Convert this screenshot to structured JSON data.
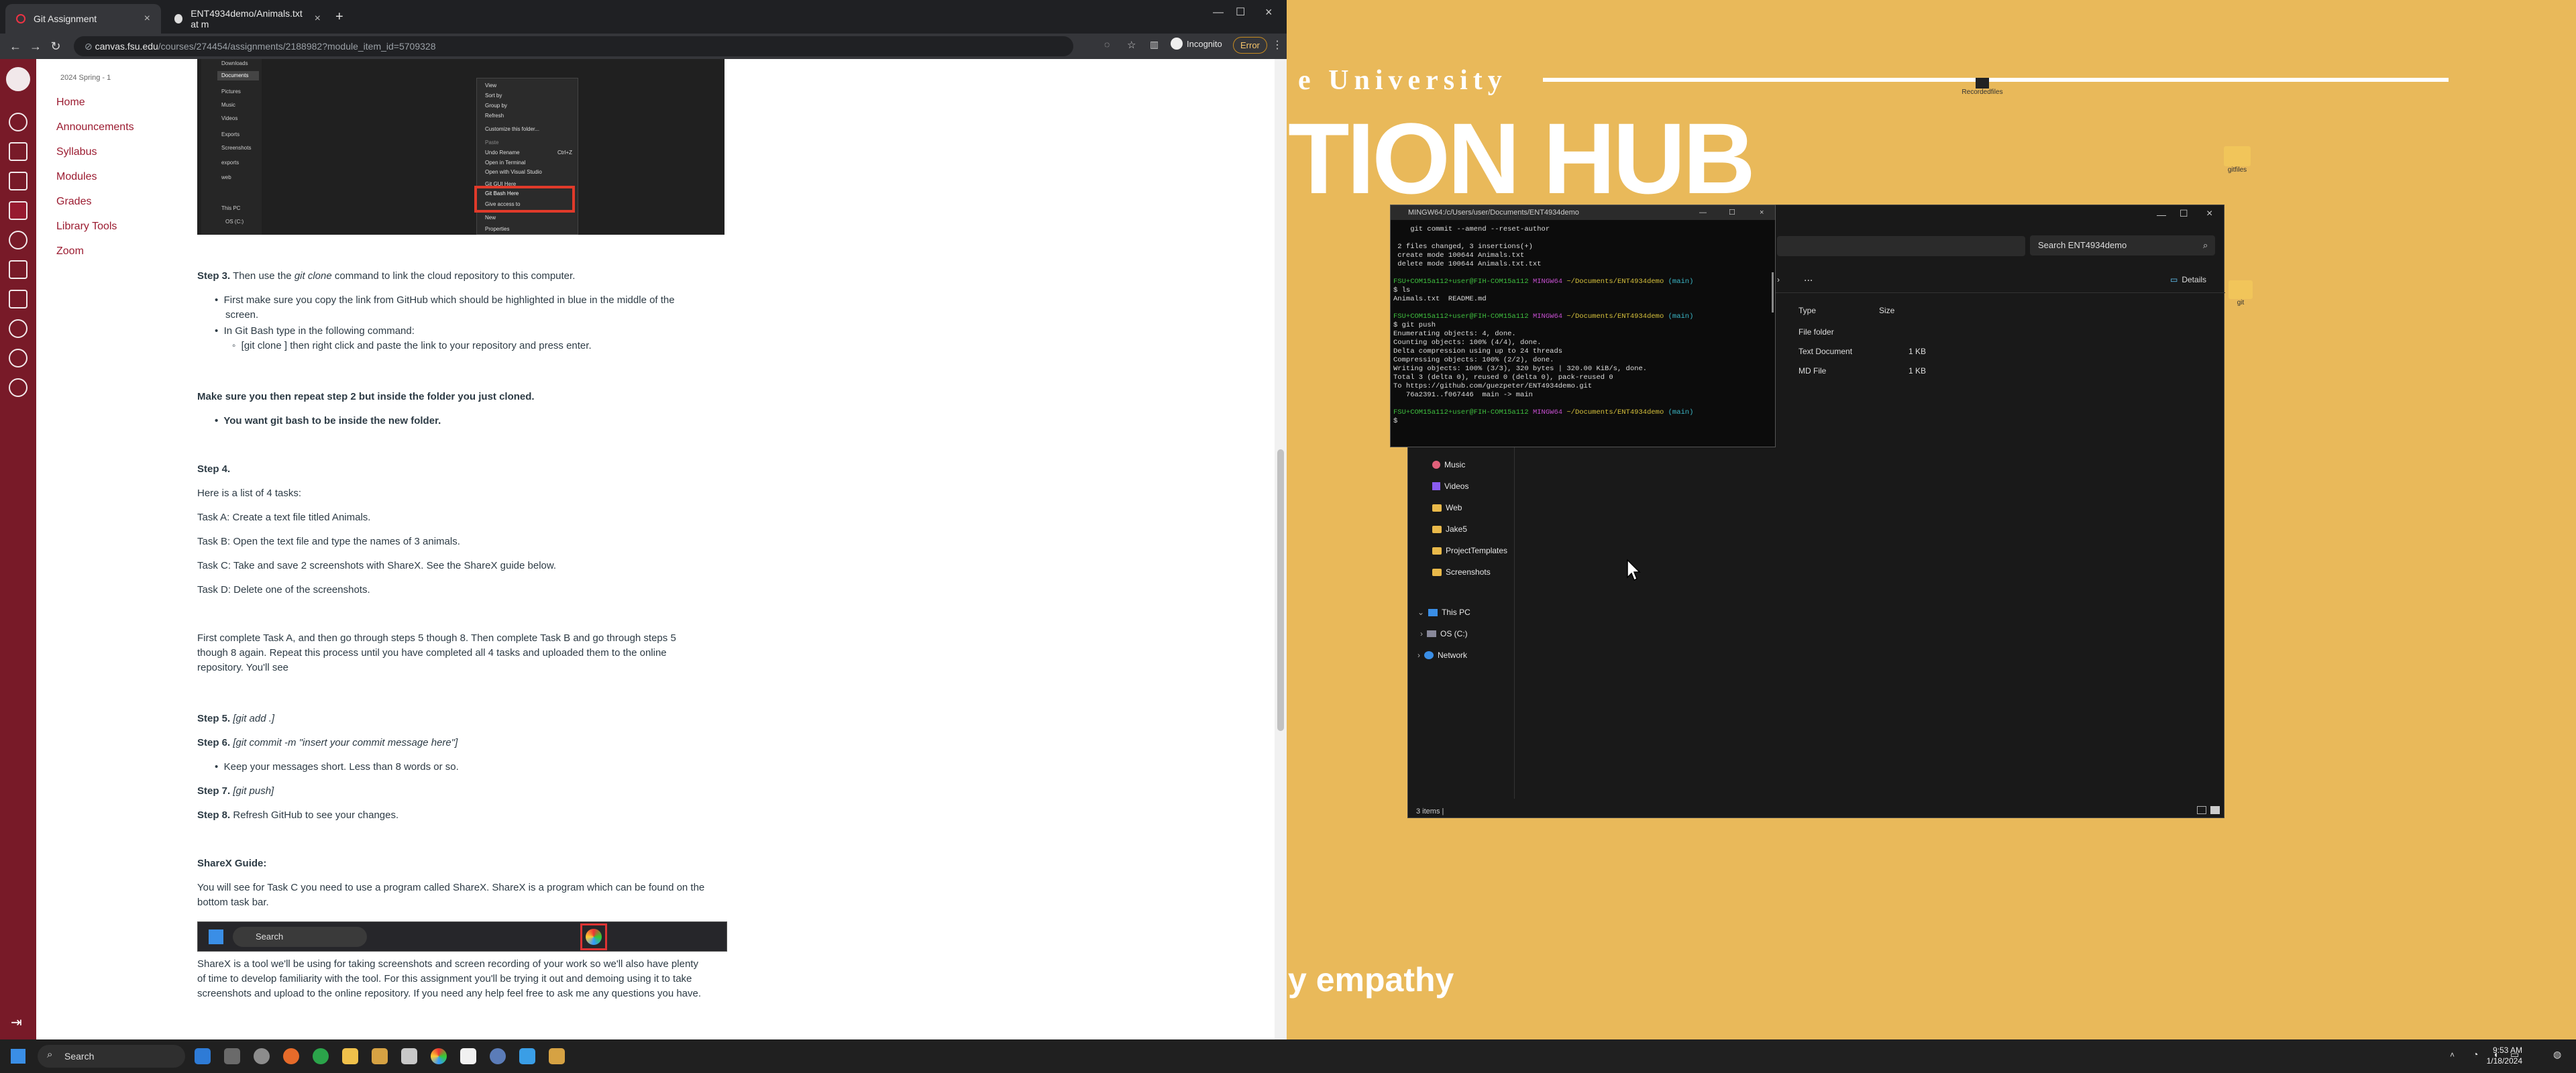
{
  "browser": {
    "tabs": [
      {
        "title": "Git Assignment",
        "active": true
      },
      {
        "title": "ENT4934demo/Animals.txt at m",
        "active": false
      }
    ],
    "new_tab": "+",
    "url_host": "canvas.fsu.edu",
    "url_path": "/courses/274454/assignments/2188982?module_item_id=5709328",
    "incognito_label": "Incognito",
    "error_label": "Error"
  },
  "canvas": {
    "term": "2024 Spring - 1",
    "course_nav": [
      "Home",
      "Announcements",
      "Syllabus",
      "Modules",
      "Grades",
      "Library Tools",
      "Zoom"
    ],
    "context_menu": [
      "View",
      "Sort by",
      "Group by",
      "Refresh",
      "Customize this folder...",
      "Paste",
      "Undo Rename",
      "Ctrl+Z",
      "Open in Terminal",
      "Open with Visual Studio",
      "Git GUI Here",
      "Git Bash Here",
      "Give access to",
      "New",
      "Properties"
    ],
    "shot_sidebar": [
      "Downloads",
      "Documents",
      "Pictures",
      "Music",
      "Videos",
      "Exports",
      "Screenshots",
      "exports",
      "web",
      "This PC",
      "OS (C:)"
    ]
  },
  "content": {
    "step3_label": "Step 3.",
    "step3_a": " Then use the ",
    "step3_cmd": "git clone",
    "step3_b": " command to link the cloud repository to this computer.",
    "bullet1": "First make sure you copy the link from GitHub which should be highlighted in blue in the middle of the",
    "bullet1b": "screen.",
    "bullet2": "In Git Bash type in the following command:",
    "sub1": "[git clone ] then right click and paste the link to your repository and press enter.",
    "repeat": "Make sure you then repeat step 2 but inside the folder you just cloned.",
    "repeat_bullet": "You want git bash to be inside the new folder.",
    "step4": "Step 4.",
    "tasks_intro": "Here is a list of 4 tasks:",
    "taskA": "Task A: Create a text file titled Animals.",
    "taskB": "Task B: Open the text file and type the names of 3 animals.",
    "taskC": "Task C: Take and save 2 screenshots with ShareX. See the ShareX guide below.",
    "taskD": "Task D: Delete one of the screenshots.",
    "para1": "First complete Task A, and then go through steps 5 though 8. Then complete Task B and go through steps 5",
    "para2": "though 8 again. Repeat this process until you have completed all 4 tasks and uploaded them to the online",
    "para3": "repository. You'll see",
    "step5_label": "Step 5.",
    "step5_cmd": " [git add .]",
    "step6_label": "Step 6.",
    "step6_cmd": " [git commit -m \"insert your commit message here\"]",
    "step6_bullet": "Keep your messages short. Less than 8 words or so.",
    "step7_label": "Step 7.",
    "step7_cmd": " [git push]",
    "step8_label": "Step 8.",
    "step8_text": " Refresh GitHub to see your changes.",
    "sharex_title": "ShareX Guide:",
    "sharex1": "You will see for Task C you need to use a program called ShareX. ShareX is a program which can be found on the",
    "sharex2": "bottom task bar.",
    "sharex_search": "Search",
    "sharex3": "ShareX is a tool we'll be using for taking screenshots and screen recording of your work so we'll also have plenty",
    "sharex4": "of time to develop familiarity with the tool. For this assignment you'll be trying it out and demoing using it to take",
    "sharex5": "screenshots and upload to the online repository. If you need any help feel free to ask me any questions you have."
  },
  "desktop": {
    "university": "e University",
    "hub": "TION HUB",
    "empathy": "y empathy",
    "icon1_label": "Recordedfiles",
    "icon2_label": "gitfiles",
    "icon3_label": "git"
  },
  "terminal": {
    "title": "MINGW64:/c/Users/user/Documents/ENT4934demo",
    "lines": [
      {
        "t": "    git commit --amend --reset-author",
        "c": ""
      },
      {
        "t": "",
        "c": ""
      },
      {
        "t": " 2 files changed, 3 insertions(+)",
        "c": ""
      },
      {
        "t": " create mode 100644 Animals.txt",
        "c": ""
      },
      {
        "t": " delete mode 100644 Animals.txt.txt",
        "c": ""
      },
      {
        "t": "",
        "c": ""
      },
      {
        "t": "FSU+COM15a112+user@FIH-COM15a112 MINGW64 ~/Documents/ENT4934demo (main)",
        "c": "prompt"
      },
      {
        "t": "$ ls",
        "c": ""
      },
      {
        "t": "Animals.txt  README.md",
        "c": ""
      },
      {
        "t": "",
        "c": ""
      },
      {
        "t": "FSU+COM15a112+user@FIH-COM15a112 MINGW64 ~/Documents/ENT4934demo (main)",
        "c": "prompt"
      },
      {
        "t": "$ git push",
        "c": ""
      },
      {
        "t": "Enumerating objects: 4, done.",
        "c": ""
      },
      {
        "t": "Counting objects: 100% (4/4), done.",
        "c": ""
      },
      {
        "t": "Delta compression using up to 24 threads",
        "c": ""
      },
      {
        "t": "Compressing objects: 100% (2/2), done.",
        "c": ""
      },
      {
        "t": "Writing objects: 100% (3/3), 320 bytes | 320.00 KiB/s, done.",
        "c": ""
      },
      {
        "t": "Total 3 (delta 0), reused 0 (delta 0), pack-reused 0",
        "c": ""
      },
      {
        "t": "To https://github.com/guezpeter/ENT4934demo.git",
        "c": ""
      },
      {
        "t": "   76a2391..f067446  main -> main",
        "c": ""
      },
      {
        "t": "",
        "c": ""
      },
      {
        "t": "FSU+COM15a112+user@FIH-COM15a112 MINGW64 ~/Documents/ENT4934demo (main)",
        "c": "prompt"
      },
      {
        "t": "$ ",
        "c": ""
      }
    ]
  },
  "explorer": {
    "search_placeholder": "Search ENT4934demo",
    "more": "...",
    "details": "Details",
    "col_type": "Type",
    "col_size": "Size",
    "rows": [
      {
        "type": "File folder",
        "size": ""
      },
      {
        "type": "Text Document",
        "size": "1 KB"
      },
      {
        "type": "MD File",
        "size": "1 KB"
      }
    ],
    "sidebar": [
      "Music",
      "Videos",
      "Web",
      "Jake5",
      "ProjectTemplates",
      "Screenshots",
      "This PC",
      "OS (C:)",
      "Network"
    ],
    "status": "3 items  |"
  },
  "taskbar": {
    "search": "Search",
    "time": "9:53 AM",
    "date": "1/18/2024"
  }
}
